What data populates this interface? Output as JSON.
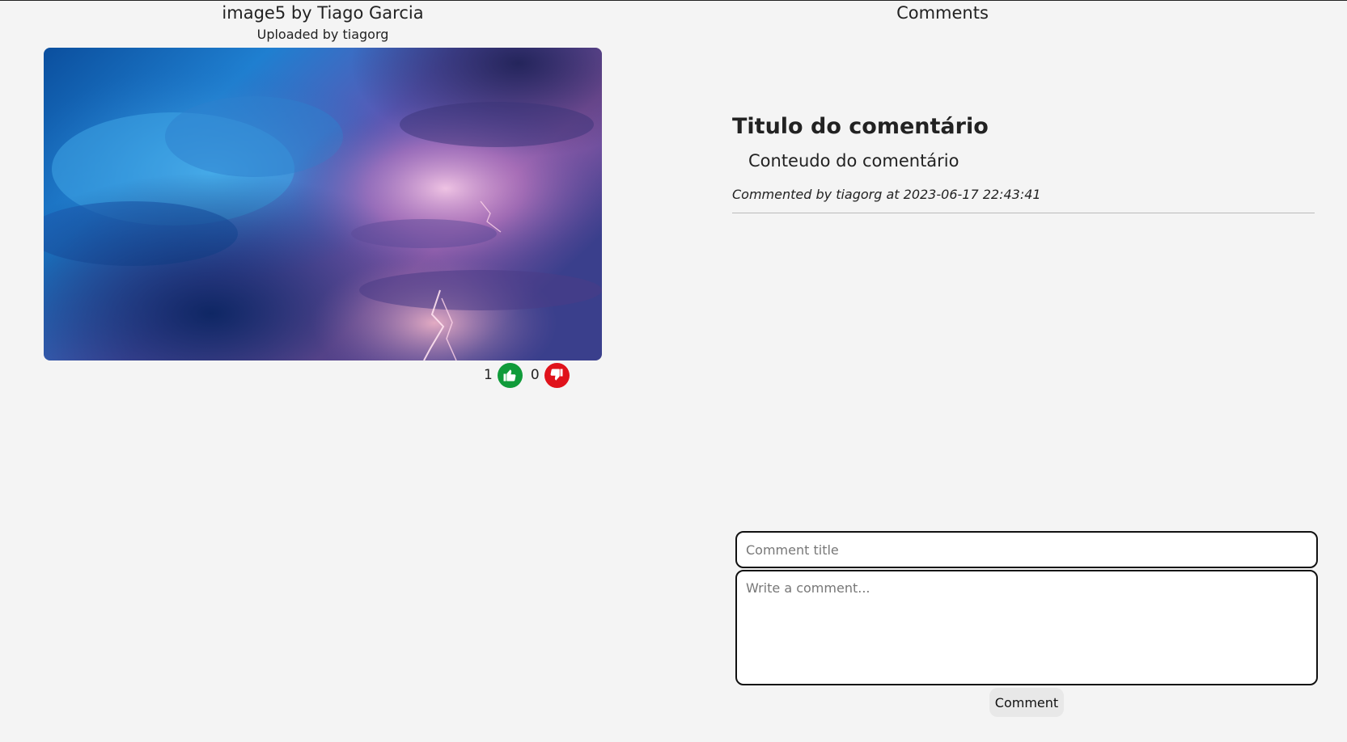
{
  "image": {
    "title": "image5 by Tiago Garcia",
    "uploader": "Uploaded by tiagorg",
    "alt": "Storm clouds with lightning"
  },
  "votes": {
    "likes": "1",
    "dislikes": "0",
    "like_icon": "thumbs-up-icon",
    "dislike_icon": "thumbs-down-icon",
    "like_color": "#109b3a",
    "dislike_color": "#e0121b"
  },
  "comments": {
    "heading": "Comments",
    "items": [
      {
        "title": "Titulo do comentário",
        "body": "Conteudo do comentário",
        "meta": "Commented by tiagorg at 2023-06-17 22:43:41"
      }
    ]
  },
  "form": {
    "title_placeholder": "Comment title",
    "title_value": "",
    "body_placeholder": "Write a comment...",
    "body_value": "",
    "submit_label": "Comment"
  }
}
